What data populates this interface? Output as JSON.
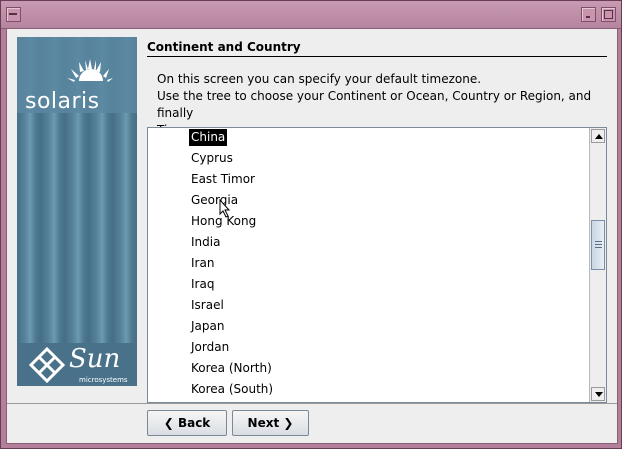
{
  "window": {
    "title": ""
  },
  "sidebar": {
    "logo_text": "solaris",
    "sun_text": "Sun",
    "micro_text": "microsystems"
  },
  "page": {
    "heading": "Continent and Country",
    "description_line1": "On this screen you can specify your default timezone.",
    "description_line2": "Use the tree to choose your Continent or Ocean, Country or Region, and finally",
    "description_line3": "Timezone."
  },
  "countries": {
    "selected": "China",
    "items": [
      "China",
      "Cyprus",
      "East Timor",
      "Georgia",
      "Hong Kong",
      "India",
      "Iran",
      "Iraq",
      "Israel",
      "Japan",
      "Jordan",
      "Korea (North)",
      "Korea (South)"
    ]
  },
  "buttons": {
    "back": "Back",
    "next": "Next"
  },
  "icons": {
    "back": "chevron-left-icon",
    "next": "chevron-right-icon",
    "logo": "sun-rays-icon"
  },
  "colors": {
    "titlebar": "#b5849e",
    "sidebar": "#5a879e",
    "selection": "#000000"
  }
}
